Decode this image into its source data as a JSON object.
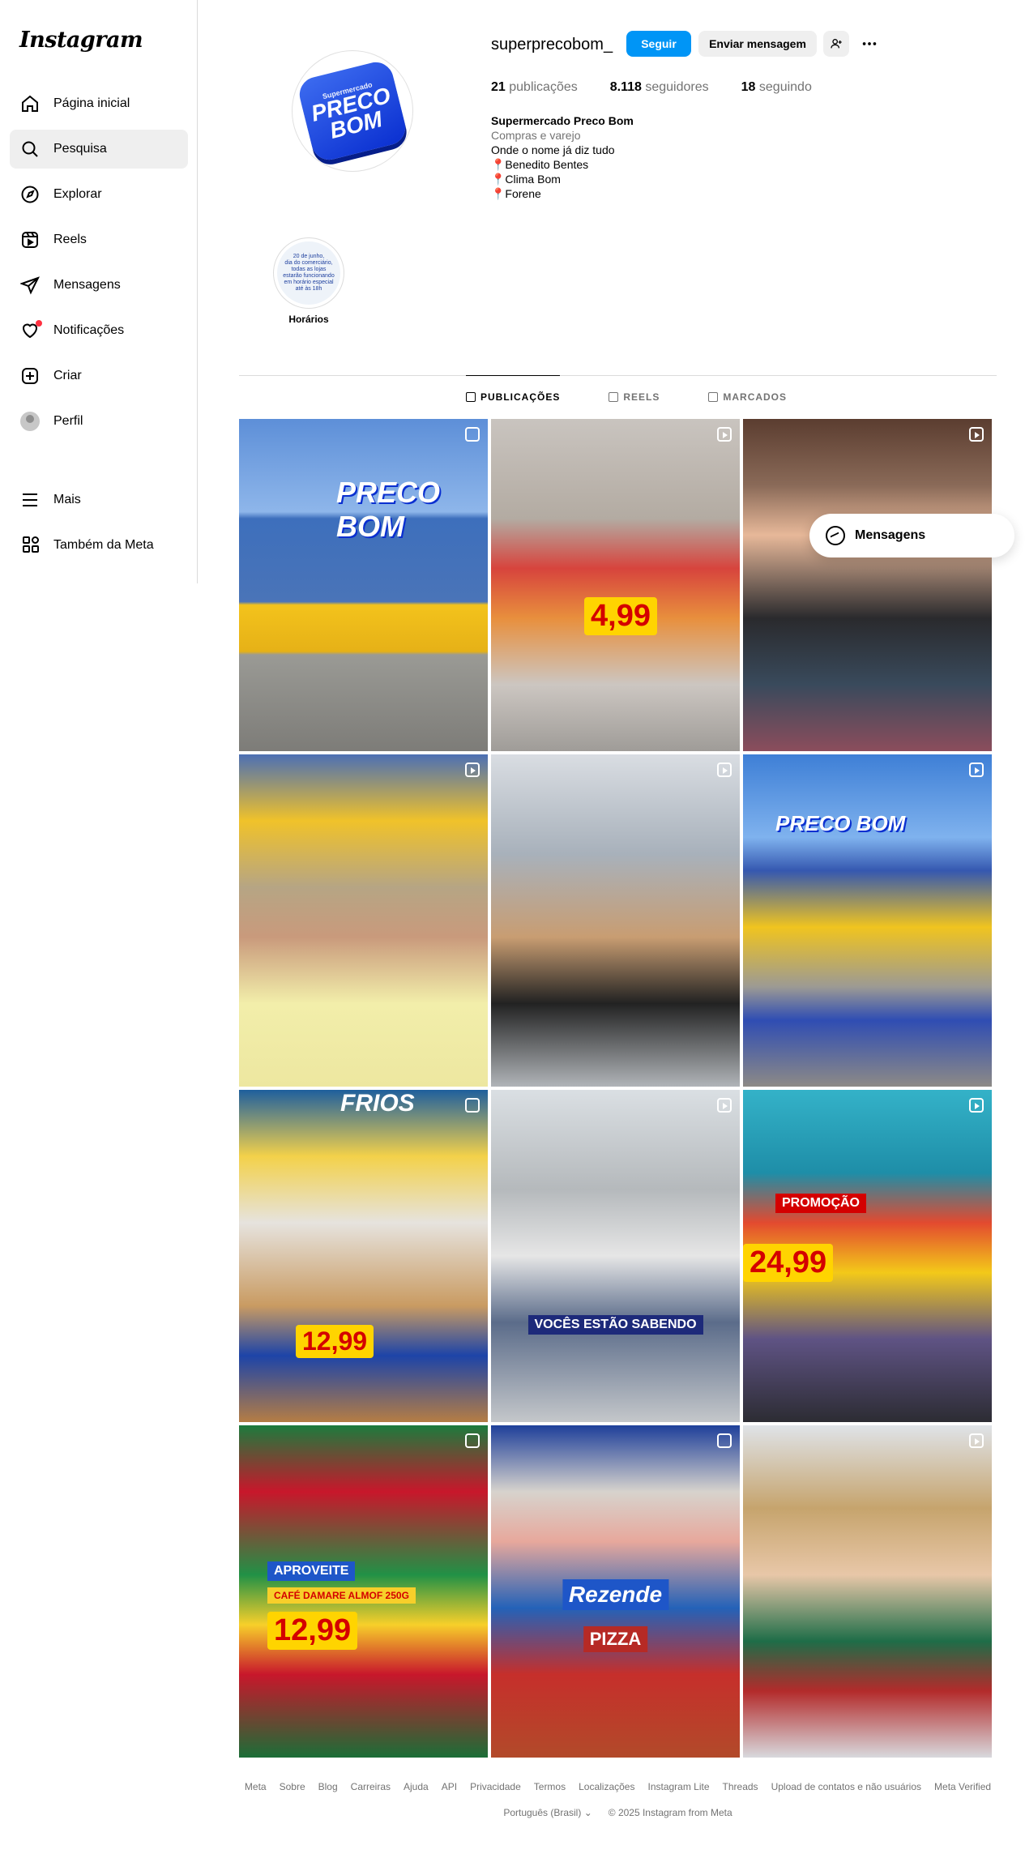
{
  "sidebar": {
    "logo": "Instagram",
    "items": [
      {
        "label": "Página inicial",
        "icon": "home-icon"
      },
      {
        "label": "Pesquisa",
        "icon": "search-icon"
      },
      {
        "label": "Explorar",
        "icon": "compass-icon"
      },
      {
        "label": "Reels",
        "icon": "reels-icon"
      },
      {
        "label": "Mensagens",
        "icon": "send-icon"
      },
      {
        "label": "Notificações",
        "icon": "heart-icon"
      },
      {
        "label": "Criar",
        "icon": "plus-square-icon"
      },
      {
        "label": "Perfil",
        "icon": "avatar"
      }
    ],
    "bottom": [
      {
        "label": "Mais",
        "icon": "menu-icon"
      },
      {
        "label": "Também da Meta",
        "icon": "meta-apps-icon"
      }
    ]
  },
  "profile": {
    "username": "superprecobom_",
    "follow_label": "Seguir",
    "message_label": "Enviar mensagem",
    "logo_small": "Supermercado",
    "logo_line1": "PRECO",
    "logo_line2": "BOM",
    "stats": {
      "posts_count": "21",
      "posts_label": "publicações",
      "followers_count": "8.118",
      "followers_label": "seguidores",
      "following_count": "18",
      "following_label": "seguindo"
    },
    "bio": {
      "name": "Supermercado Preco Bom",
      "category": "Compras e varejo",
      "line1": "Onde o nome já diz tudo",
      "loc1": "📍Benedito Bentes",
      "loc2": "📍Clima Bom",
      "loc3": "📍Forene"
    }
  },
  "highlight": {
    "label": "Horários",
    "text1": "20 de junho,",
    "text2": "dia do comerciário,",
    "text3": "todas as lojas",
    "text4": "estarão funcionando",
    "text5": "em horário especial",
    "text6": "até às 18h"
  },
  "tabs": [
    {
      "label": "PUBLICAÇÕES",
      "active": true
    },
    {
      "label": "REELS",
      "active": false
    },
    {
      "label": "MARCADOS",
      "active": false
    }
  ],
  "posts": {
    "p1_sign": "PRECO BOM",
    "p2_price": "4,99",
    "p6_sign": "PRECO BOM",
    "p7_price": "12,99",
    "p7_sign": "FRIOS",
    "p8_caption": "VOCÊS ESTÃO SABENDO",
    "p9_price": "24,99",
    "p9_promo": "PROMOÇÃO",
    "p10_promo": "APROVEITE",
    "p10_desc": "CAFÉ DAMARE ALMOF 250G",
    "p10_price": "12,99",
    "p11_brand": "Rezende",
    "p11_product": "PIZZA"
  },
  "floating_messages": "Mensagens",
  "footer": {
    "links": [
      "Meta",
      "Sobre",
      "Blog",
      "Carreiras",
      "Ajuda",
      "API",
      "Privacidade",
      "Termos",
      "Localizações",
      "Instagram Lite",
      "Threads",
      "Upload de contatos e não usuários",
      "Meta Verified"
    ],
    "language": "Português (Brasil)",
    "copyright": "© 2025 Instagram from Meta"
  }
}
